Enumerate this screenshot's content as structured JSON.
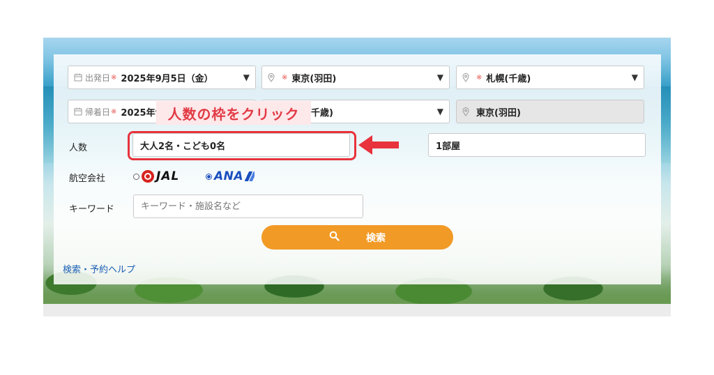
{
  "form": {
    "departure_date": {
      "label": "出発日",
      "value": "2025年9月5日（金）"
    },
    "origin": {
      "value": "東京(羽田)"
    },
    "destination": {
      "value": "札幌(千歳)"
    },
    "return_date": {
      "label": "帰着日",
      "value_visible": "2025年9"
    },
    "return_origin": {
      "value_visible": "千歳)"
    },
    "return_destination": {
      "value": "東京(羽田)"
    },
    "required_mark": "※",
    "people": {
      "label": "人数",
      "value": "大人2名・こども0名"
    },
    "rooms": {
      "value": "1部屋"
    },
    "airline": {
      "label": "航空会社",
      "options": [
        {
          "name": "JAL",
          "selected": false
        },
        {
          "name": "ANA",
          "selected": true
        }
      ]
    },
    "keyword": {
      "label": "キーワード",
      "placeholder": "キーワード・施設名など"
    },
    "search_button": {
      "label": "検索"
    },
    "help_link": "検索・予約ヘルプ"
  },
  "annotation": {
    "callout_text": "人数の枠をクリック",
    "color": "#e8323c"
  },
  "colors": {
    "accent_orange": "#f19a26",
    "link_blue": "#1a5fb4",
    "required_red": "#e4524c"
  }
}
